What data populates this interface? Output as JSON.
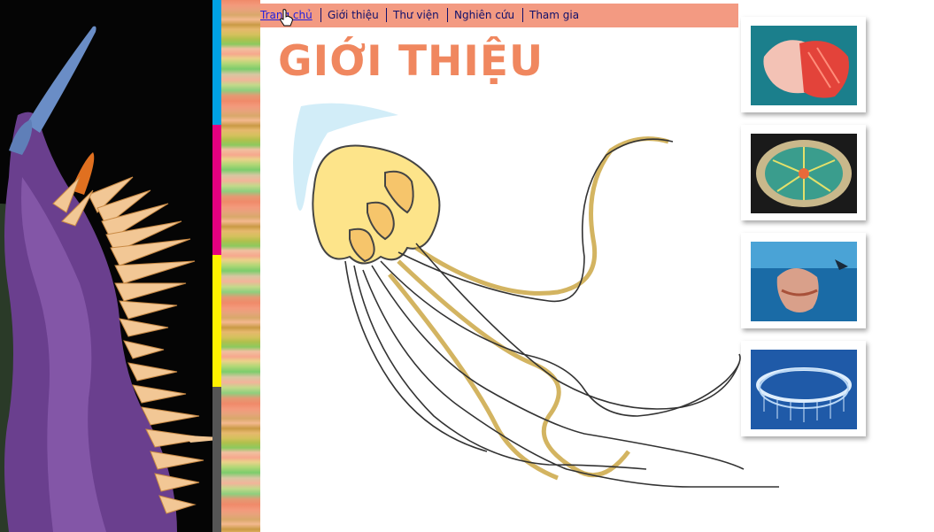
{
  "nav": {
    "items": [
      {
        "label": "Trang chủ",
        "current": true
      },
      {
        "label": "Giới thiệu",
        "current": false
      },
      {
        "label": "Thư viện",
        "current": false
      },
      {
        "label": "Nghiên cứu",
        "current": false
      },
      {
        "label": "Tham gia",
        "current": false
      }
    ]
  },
  "main": {
    "title": "GIỚI THIỆU",
    "illustration_icon": "jellyfish-sketch-illustration"
  },
  "left_panel": {
    "photo_icon": "sea-slug-photo",
    "color_bar": [
      "#00a0e3",
      "#e4007f",
      "#fff200",
      "#555555"
    ]
  },
  "gallery": {
    "thumbnails": [
      {
        "icon": "red-jellyfish-photo"
      },
      {
        "icon": "disc-jellyfish-photo"
      },
      {
        "icon": "lions-mane-jellyfish-diver-photo"
      },
      {
        "icon": "transparent-ring-jellyfish-photo"
      }
    ]
  },
  "colors": {
    "nav_background": "#f39a82",
    "title": "#f0875f",
    "nav_text": "#10106b"
  }
}
